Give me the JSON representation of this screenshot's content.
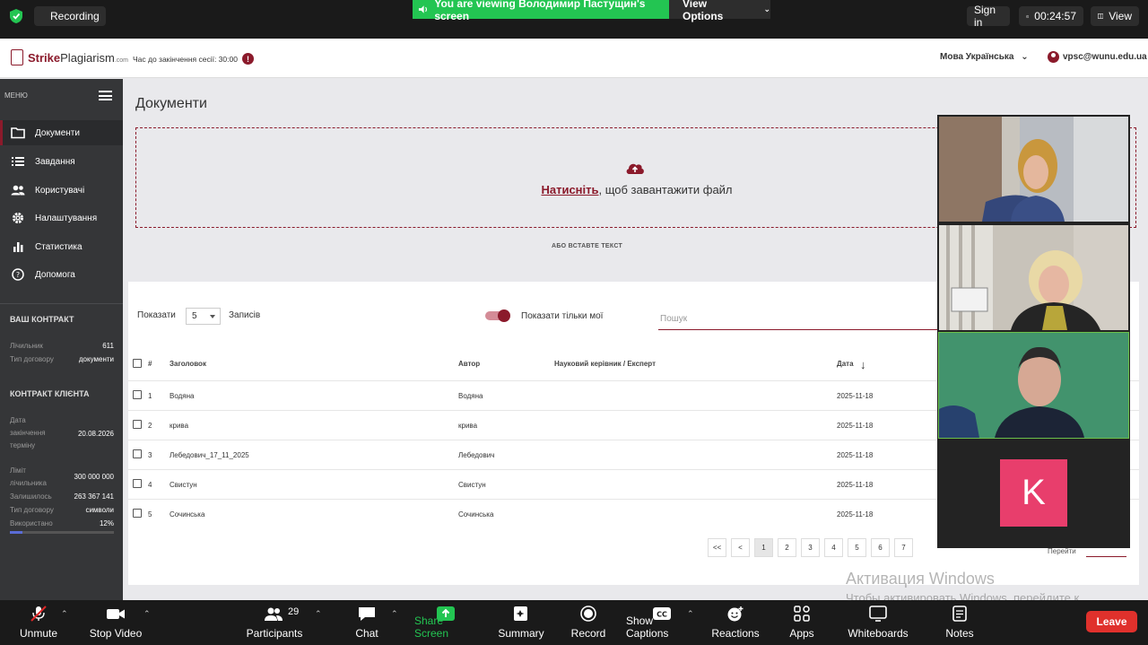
{
  "zoom_top": {
    "recording": "Recording",
    "viewing_banner": "You are viewing Володимир Пастущин's screen",
    "view_options": "View Options",
    "sign_in": "Sign in",
    "timer": "00:24:57",
    "view": "View"
  },
  "header": {
    "logo_prefix": "Strike",
    "logo_main": "Plagiarism",
    "logo_suffix": ".com",
    "session_text": "Час до закінчення сесії: 30:00",
    "info": "!",
    "language": "Мова Українська",
    "user_email": "vpsc@wunu.edu.ua"
  },
  "sidebar": {
    "menu_label": "МЕНЮ",
    "items": [
      {
        "label": "Документи",
        "icon": "folder-icon"
      },
      {
        "label": "Завдання",
        "icon": "list-icon"
      },
      {
        "label": "Користувачі",
        "icon": "users-icon"
      },
      {
        "label": "Налаштування",
        "icon": "gear-icon"
      },
      {
        "label": "Статистика",
        "icon": "bar-chart-icon"
      },
      {
        "label": "Допомога",
        "icon": "help-icon"
      }
    ],
    "contract_title": "ВАШ КОНТРАКТ",
    "counter_label": "Лічильник",
    "counter_value": "611",
    "contract_type_label": "Тип договору",
    "contract_type_value": "документи",
    "client_title": "КОНТРАКТ КЛІЄНТА",
    "end_date_label_1": "Дата",
    "end_date_label_2": "закінчення",
    "end_date_label_3": "терміну",
    "end_date_value": "20.08.2026",
    "limit_label_1": "Ліміт",
    "limit_label_2": "лічильника",
    "limit_value": "300 000 000",
    "remaining_label": "Залишилось",
    "remaining_value": "263 367 141",
    "client_type_label": "Тип договору",
    "client_type_value": "символи",
    "used_label": "Використано",
    "used_value": "12%",
    "used_fraction": 0.12
  },
  "main": {
    "title": "Документи",
    "upload_link": "Натисніть",
    "upload_text": ", щоб завантажити файл",
    "or_paste": "АБО ВСТАВТЕ ТЕКСТ",
    "show_label": "Показати",
    "page_size": "5",
    "records_label": "Записів",
    "only_mine": "Показати тільки мої",
    "search_placeholder": "Пошук",
    "columns": {
      "num": "#",
      "title": "Заголовок",
      "author": "Автор",
      "supervisor": "Науковий керівник / Експерт",
      "date": "Дата"
    },
    "rows": [
      {
        "num": "1",
        "title": "Водяна",
        "author": "Водяна",
        "date": "2025-11-18"
      },
      {
        "num": "2",
        "title": "крива",
        "author": "крива",
        "date": "2025-11-18"
      },
      {
        "num": "3",
        "title": "Лебедович_17_11_2025",
        "author": "Лебедович",
        "date": "2025-11-18"
      },
      {
        "num": "4",
        "title": "Свистун",
        "author": "Свистун",
        "date": "2025-11-18"
      },
      {
        "num": "5",
        "title": "Сочинська",
        "author": "Сочинська",
        "date": "2025-11-18"
      }
    ],
    "pagination": [
      "<<",
      "<",
      "1",
      "2",
      "3",
      "4",
      "5",
      "6",
      "7"
    ],
    "goto_label": "Перейти"
  },
  "videos": {
    "avatar_letter": "K"
  },
  "watermark": {
    "line1": "Активация Windows",
    "line2": "Чтобы активировать Windows, перейдите к параметрам компьютера."
  },
  "zoom_bottom": {
    "unmute": "Unmute",
    "stop_video": "Stop Video",
    "participants": "Participants",
    "participants_count": "29",
    "chat": "Chat",
    "share_screen": "Share Screen",
    "summary": "Summary",
    "record": "Record",
    "show_captions": "Show Captions",
    "reactions": "Reactions",
    "apps": "Apps",
    "whiteboards": "Whiteboards",
    "notes": "Notes",
    "leave": "Leave"
  },
  "colors": {
    "brand": "#8b1a2b",
    "zoom_green": "#23c552",
    "leave_red": "#e0312c",
    "avatar_pink": "#e83e6c"
  }
}
